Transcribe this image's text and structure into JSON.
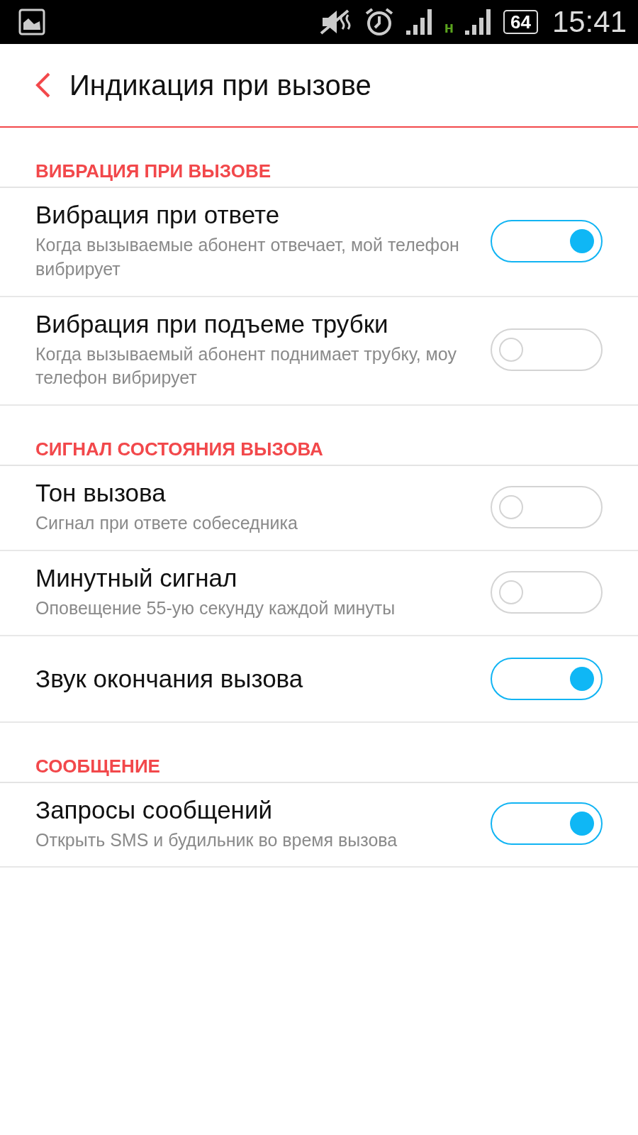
{
  "status_bar": {
    "network_label": "н",
    "battery": "64",
    "time": "15:41"
  },
  "header": {
    "title": "Индикация при вызове"
  },
  "sections": [
    {
      "title": "ВИБРАЦИЯ ПРИ ВЫЗОВЕ",
      "items": [
        {
          "title": "Вибрация при ответе",
          "subtitle": "Когда вызываемые абонент отвечает, мой телефон вибрирует",
          "on": true
        },
        {
          "title": "Вибрация при подъеме трубки",
          "subtitle": "Когда вызываемый абонент поднимает трубку, моу телефон вибрирует",
          "on": false
        }
      ]
    },
    {
      "title": "СИГНАЛ СОСТОЯНИЯ ВЫЗОВА",
      "items": [
        {
          "title": "Тон вызова",
          "subtitle": "Сигнал при ответе собеседника",
          "on": false
        },
        {
          "title": "Минутный сигнал",
          "subtitle": "Оповещение 55-ую секунду каждой минуты",
          "on": false
        },
        {
          "title": "Звук окончания вызова",
          "on": true
        }
      ]
    },
    {
      "title": "СООБЩЕНИЕ",
      "items": [
        {
          "title": "Запросы сообщений",
          "subtitle": "Открыть SMS и будильник во время вызова",
          "on": true
        }
      ]
    }
  ]
}
